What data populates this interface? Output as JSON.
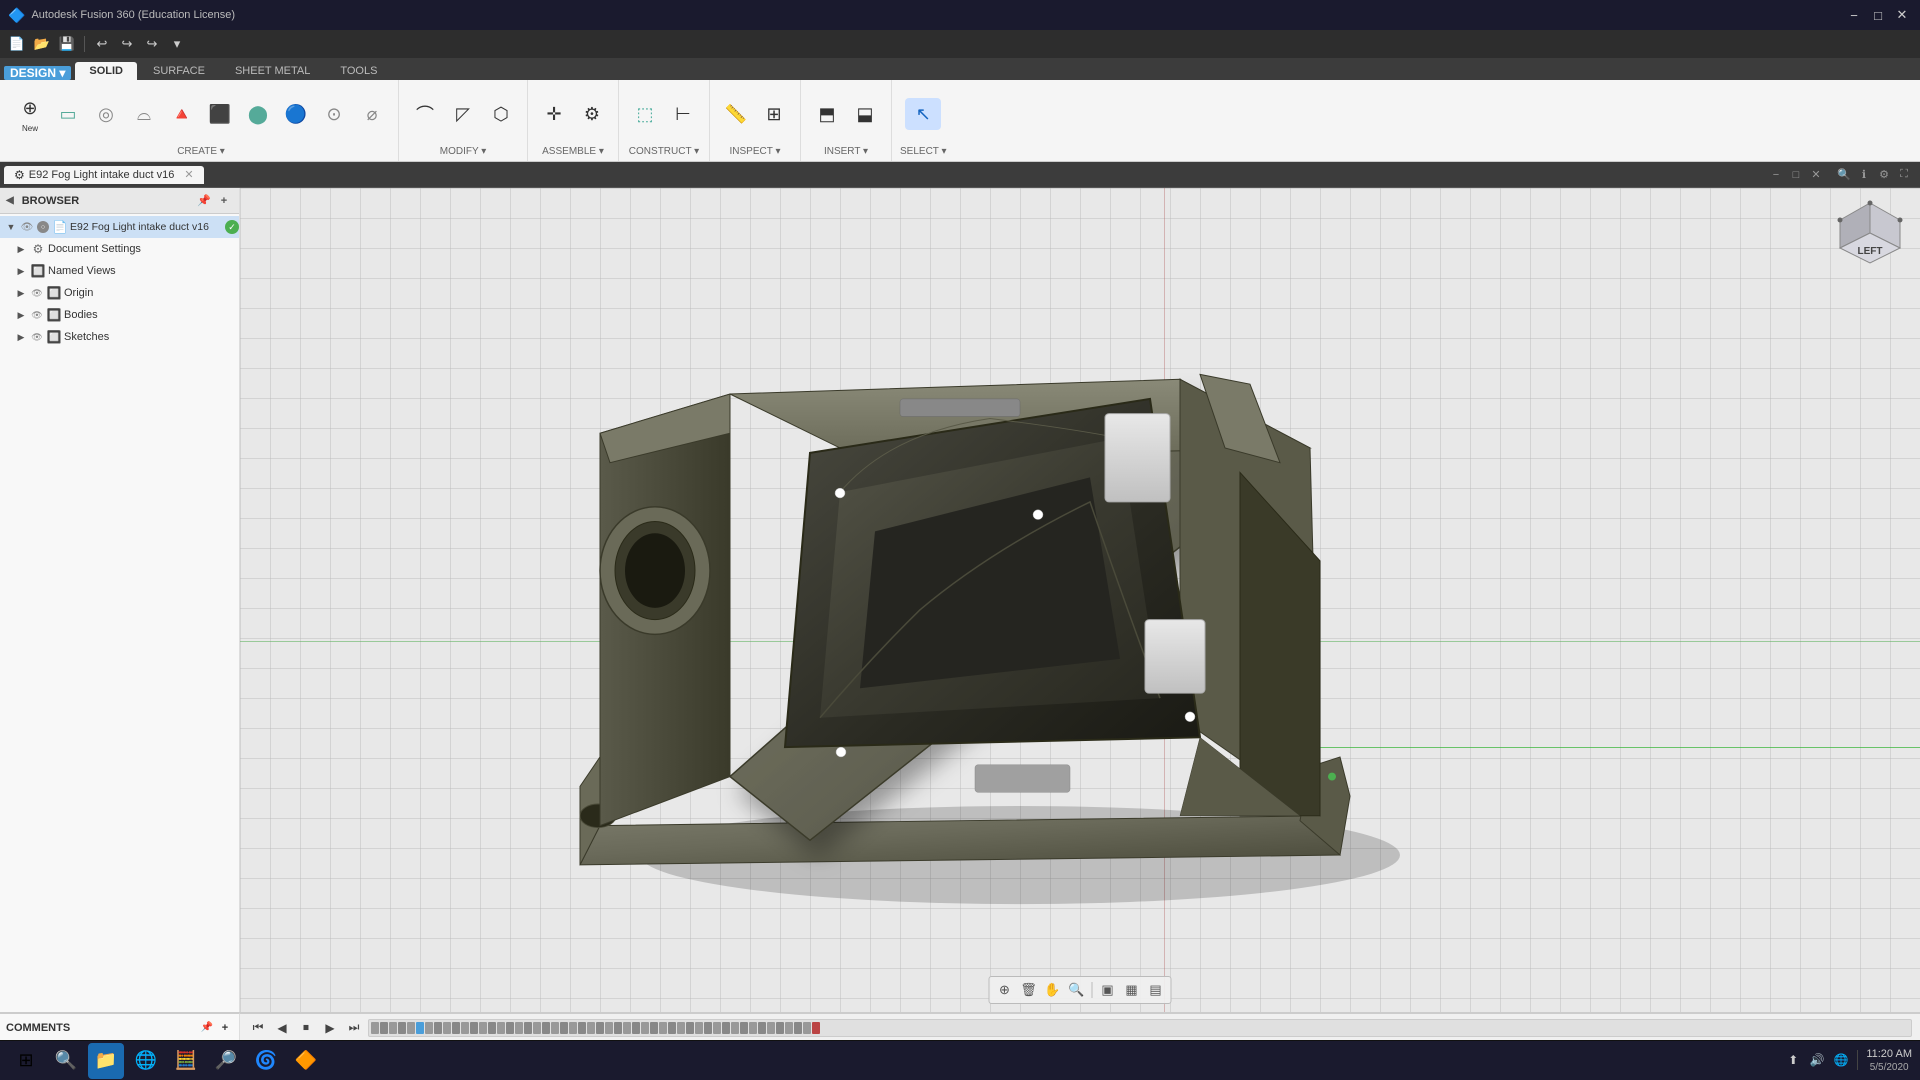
{
  "app": {
    "title": "Autodesk Fusion 360 (Education License)",
    "icon": "🔷"
  },
  "window_controls": {
    "minimize": "−",
    "maximize": "□",
    "close": "✕"
  },
  "quick_access": {
    "new_label": "New",
    "open_label": "Open",
    "save_label": "Save",
    "undo_label": "Undo",
    "redo_label": "Redo"
  },
  "ribbon": {
    "tabs": [
      {
        "id": "solid",
        "label": "SOLID",
        "active": true
      },
      {
        "id": "surface",
        "label": "SURFACE",
        "active": false
      },
      {
        "id": "sheet_metal",
        "label": "SHEET METAL",
        "active": false
      },
      {
        "id": "tools",
        "label": "TOOLS",
        "active": false
      }
    ],
    "design_label": "DESIGN ▾",
    "groups": [
      {
        "id": "create",
        "label": "CREATE ▾",
        "tools": [
          "new-component",
          "extrude",
          "revolve",
          "sweep",
          "loft",
          "box",
          "cylinder",
          "sphere",
          "torus",
          "coil",
          "pipe"
        ]
      },
      {
        "id": "modify",
        "label": "MODIFY ▾",
        "tools": []
      },
      {
        "id": "assemble",
        "label": "ASSEMBLE ▾",
        "tools": []
      },
      {
        "id": "construct",
        "label": "CONSTRUCT ▾",
        "tools": []
      },
      {
        "id": "inspect",
        "label": "INSPECT ▾",
        "tools": []
      },
      {
        "id": "insert",
        "label": "INSERT ▾",
        "tools": []
      },
      {
        "id": "select",
        "label": "SELECT ▾",
        "tools": []
      }
    ]
  },
  "doc_tab": {
    "label": "E92 Fog Light intake duct v16",
    "icon": "⚙",
    "close": "✕",
    "tab_controls": [
      "−",
      "□",
      "✕"
    ]
  },
  "browser": {
    "title": "BROWSER",
    "expand_icon": "◀",
    "pin_icon": "📌",
    "add_icon": "+",
    "items": [
      {
        "id": "root",
        "indent": 0,
        "arrow": "▼",
        "icon": "📄",
        "label": "E92 Fog Light intake duct v16",
        "eye": true,
        "check": true,
        "badge": "✓"
      },
      {
        "id": "doc-settings",
        "indent": 1,
        "arrow": "▶",
        "icon": "⚙",
        "label": "Document Settings",
        "eye": false,
        "check": false
      },
      {
        "id": "named-views",
        "indent": 1,
        "arrow": "▶",
        "icon": "🔲",
        "label": "Named Views",
        "eye": false,
        "check": false
      },
      {
        "id": "origin",
        "indent": 1,
        "arrow": "▶",
        "icon": "🔲",
        "label": "Origin",
        "eye": true,
        "check": false
      },
      {
        "id": "bodies",
        "indent": 1,
        "arrow": "▶",
        "icon": "🔲",
        "label": "Bodies",
        "eye": true,
        "check": false
      },
      {
        "id": "sketches",
        "indent": 1,
        "arrow": "▶",
        "icon": "🔲",
        "label": "Sketches",
        "eye": true,
        "check": false
      }
    ]
  },
  "viewport": {
    "axis_hint": "axis lines",
    "navcube_label": "LEFT",
    "bg_color": "#e8e8e8"
  },
  "viewport_toolbar": {
    "buttons": [
      "⊕",
      "🗑",
      "✋",
      "🔍",
      "±",
      "▣",
      "▦",
      "▤"
    ]
  },
  "timeline": {
    "controls": [
      "⏮",
      "◀",
      "⏹",
      "▶",
      "⏭"
    ],
    "marker_count": 50
  },
  "comments": {
    "title": "COMMENTS",
    "pin_icon": "📌",
    "add_icon": "+"
  },
  "taskbar": {
    "start_icon": "⊞",
    "apps": [
      {
        "id": "explorer",
        "icon": "📁",
        "label": "File Explorer"
      },
      {
        "id": "chrome",
        "icon": "🌐",
        "label": "Google Chrome"
      },
      {
        "id": "calc",
        "icon": "🧮",
        "label": "Calculator"
      },
      {
        "id": "search",
        "icon": "🔍",
        "label": "Search"
      },
      {
        "id": "edge",
        "icon": "🌀",
        "label": "Microsoft Edge"
      },
      {
        "id": "fusion",
        "icon": "🔶",
        "label": "Fusion 360",
        "active": true
      }
    ],
    "tray": {
      "time": "11:20 AM",
      "date": "5/5/2020",
      "icons": [
        "⬆",
        "🔊",
        "🌐"
      ]
    }
  }
}
